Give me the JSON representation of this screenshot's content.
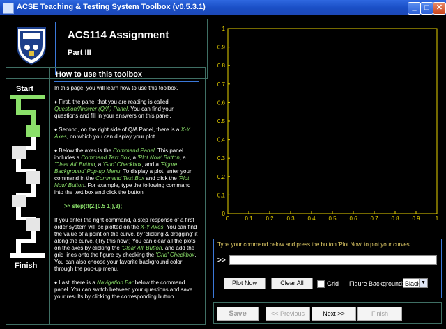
{
  "window": {
    "title": "ACSE Teaching & Testing System Toolbox (v0.5.3.1)",
    "buttons": {
      "minimize": "_",
      "maximize": "□",
      "close": "✕"
    }
  },
  "header": {
    "title": "ACS114 Assignment",
    "subtitle": "Part III"
  },
  "navigation_progress": {
    "start_label": "Start",
    "finish_label": "Finish",
    "completed_fraction": 0.2
  },
  "qa_panel": {
    "title": "How to use this toolbox",
    "intro": "In this page, you will learn how to use this toolbox.",
    "p1_a": "♦ First, the panel that you are reading is called ",
    "p1_hl": "Question/Answer (Q/A) Panel",
    "p1_b": ". You can find your questions and fill in your answers on this panel.",
    "p2_a": "♦ Second, on the right side of Q/A Panel, there is a ",
    "p2_hl": "X-Y Axes",
    "p2_b": ", on which you can display your plot.",
    "p3_a": "♦ Below the axes is the ",
    "p3_hl1": "Command Panel",
    "p3_b": ". This panel includes a ",
    "p3_hl2": "Command Text Box",
    "p3_c": ", a ",
    "p3_hl3": "'Plot Now' Button",
    "p3_d": ", a ",
    "p3_hl4": "'Clear All' Button",
    "p3_e": ", a ",
    "p3_hl5": "'Grid' Checkbox",
    "p3_f": ", and a ",
    "p3_hl6": "'Figure Background' Pop-up Menu",
    "p3_g": ". To display a plot, enter your command in the ",
    "p3_hl7": "Command Text Box",
    "p3_h": " and click the ",
    "p3_hl8": "'Plot Now' Button",
    "p3_i": ". For example, type the following command into the text box and click the button",
    "example_cmd": ">> step(tf(2,[0.5 1]),3);",
    "p4_a": "If you enter the right command, a step response of a first order system will be plotted on the ",
    "p4_hl1": "X-Y Axes",
    "p4_b": ". You can find the value of a point on the curve, by 'clicking & dragging' it along the curve. (Try this now!) You can clear all the plots on the axes by clicking the ",
    "p4_hl2": "'Clear All' Button",
    "p4_c": ", and add the grid lines onto the figure by checking the ",
    "p4_hl3": "'Grid' Checkbox",
    "p4_d": ". You can also choose your favorite background color through the pop-up menu.",
    "p5_a": "♦ Last, there is a ",
    "p5_hl": "Navigation Bar",
    "p5_b": " below the command panel. You can switch between your questions and save your results by clicking the corresponding button."
  },
  "plot": {
    "x_ticks": [
      "0",
      "0.1",
      "0.2",
      "0.3",
      "0.4",
      "0.5",
      "0.6",
      "0.7",
      "0.8",
      "0.9",
      "1"
    ],
    "y_ticks": [
      "0",
      "0.1",
      "0.2",
      "0.3",
      "0.4",
      "0.5",
      "0.6",
      "0.7",
      "0.8",
      "0.9",
      "1"
    ],
    "axes_color": "#e8d200",
    "background_color": "#000000"
  },
  "command_panel": {
    "instruction": "Type your command below and press the button 'Plot Now' to plot your curves.",
    "prompt": ">>",
    "input_value": "",
    "plot_now_label": "Plot Now",
    "clear_all_label": "Clear All",
    "grid_label": "Grid",
    "grid_checked": false,
    "figure_bg_label": "Figure Background:",
    "figure_bg_value": "Black"
  },
  "nav_bar": {
    "save_label": "Save",
    "previous_label": "<< Previous",
    "next_label": "Next >>",
    "finish_label": "Finish"
  }
}
